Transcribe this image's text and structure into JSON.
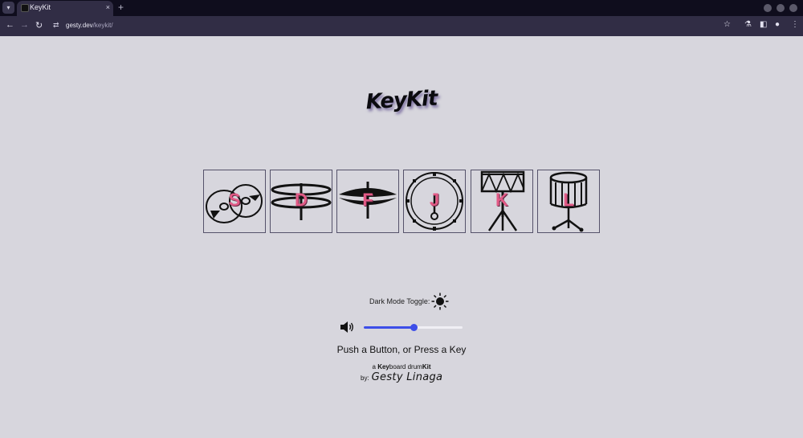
{
  "browser": {
    "tab_title": "KeyKit",
    "tab_close": "×",
    "new_tab": "+",
    "url_host": "gesty.dev",
    "url_path": "/keykit/",
    "icons": [
      "tab-search-icon",
      "back-arrow-icon",
      "forward-arrow-icon",
      "reload-icon",
      "site-info-icon",
      "bookmark-star-icon",
      "labs-flask-icon",
      "side-panel-icon",
      "profile-icon",
      "menu-dots-icon"
    ]
  },
  "page": {
    "logo": "KeyKit",
    "pads": [
      {
        "key": "S",
        "instrument": "hi-hat-open-cymbals"
      },
      {
        "key": "D",
        "instrument": "hi-hat-closed"
      },
      {
        "key": "F",
        "instrument": "crash-cymbal"
      },
      {
        "key": "J",
        "instrument": "kick-drum"
      },
      {
        "key": "K",
        "instrument": "tom-drum"
      },
      {
        "key": "L",
        "instrument": "snare-drum"
      }
    ],
    "dark_mode_label": "Dark Mode Toggle:",
    "dark_mode_icon": "sun-icon",
    "volume": 0.5,
    "instruction": "Push a Button, or Press a Key",
    "credit": {
      "a": "a",
      "key": "Key",
      "board": "board drum",
      "kit": "Kit"
    },
    "by_label": "by:",
    "author": "Gesty Linaga",
    "colors": {
      "accent": "#3d4ee8",
      "key_letter": "#e25a86",
      "background": "#d7d6dd"
    }
  }
}
